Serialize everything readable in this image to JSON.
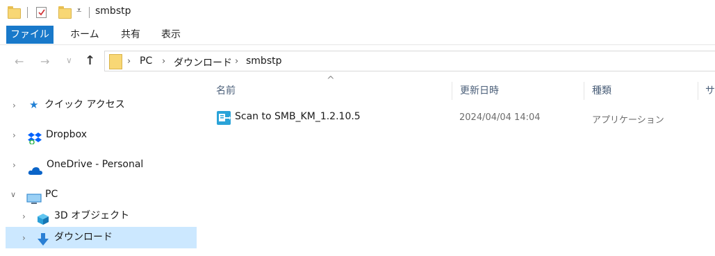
{
  "title_bar": {
    "title": "smbstp"
  },
  "ribbon": {
    "tabs": [
      "ファイル",
      "ホーム",
      "共有",
      "表示"
    ]
  },
  "address": {
    "crumbs": [
      "PC",
      "ダウンロード",
      "smbstp"
    ]
  },
  "nav_pane": {
    "items": [
      {
        "label": "クイック アクセス",
        "icon": "star-icon",
        "expanded": false
      },
      {
        "label": "Dropbox",
        "icon": "dropbox-icon",
        "expanded": false
      },
      {
        "label": "OneDrive - Personal",
        "icon": "cloud-icon",
        "expanded": false
      },
      {
        "label": "PC",
        "icon": "monitor-icon",
        "expanded": true
      },
      {
        "label": "3D オブジェクト",
        "icon": "cube-icon",
        "expanded": false
      },
      {
        "label": "ダウンロード",
        "icon": "download-arrow-icon",
        "expanded": false,
        "selected": true
      }
    ]
  },
  "file_list": {
    "columns": {
      "name": "名前",
      "modified": "更新日時",
      "type": "種類",
      "size": "サ"
    },
    "rows": [
      {
        "name": "Scan to SMB_KM_1.2.10.5",
        "modified": "2024/04/04 14:04",
        "type": "アプリケーション",
        "icon": "application-icon"
      }
    ]
  },
  "colors": {
    "accent": "#1979ca",
    "selection": "#cce8ff",
    "folder": "#f8d775"
  }
}
